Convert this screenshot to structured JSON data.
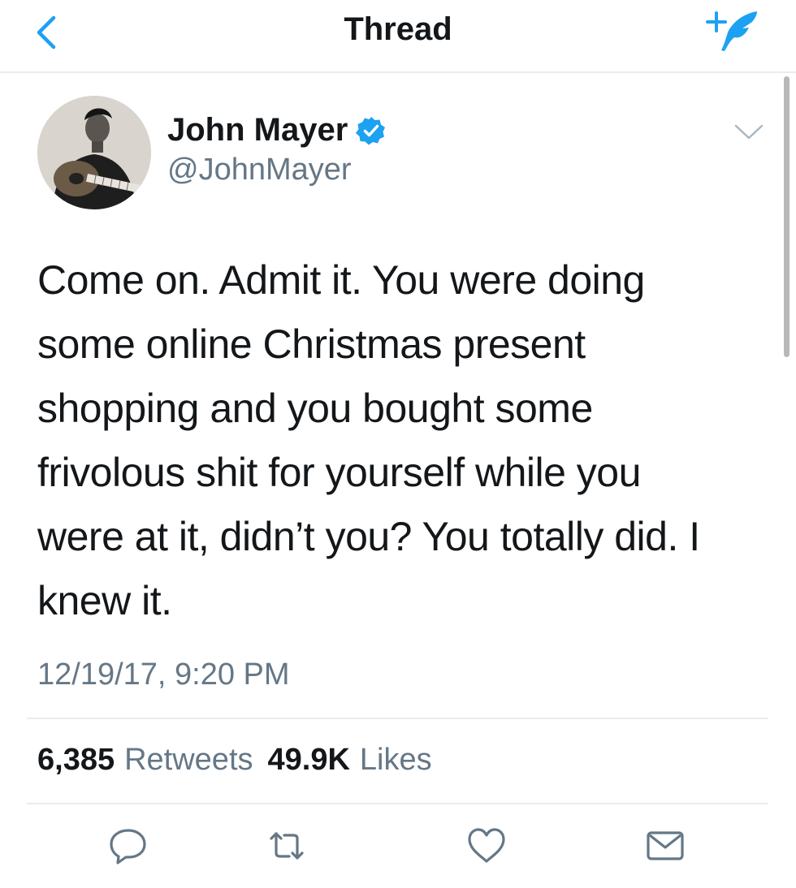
{
  "nav": {
    "title": "Thread",
    "back_icon": "chevron-left-icon",
    "compose_icon": "compose-tweet-icon"
  },
  "tweet": {
    "author_name": "John Mayer",
    "author_handle": "@JohnMayer",
    "verified": true,
    "text": "Come on. Admit it. You were doing\nsome online Christmas present\nshopping and you bought some\nfrivolous shit for yourself while you\nwere at it, didn’t you? You totally did. I\nknew it.",
    "timestamp": "12/19/17, 9:20 PM"
  },
  "stats": {
    "retweets_count": "6,385",
    "retweets_label": "Retweets",
    "likes_count": "49.9K",
    "likes_label": "Likes"
  },
  "actions": [
    "reply-icon",
    "retweet-icon",
    "like-icon",
    "share-icon"
  ],
  "colors": {
    "accent": "#1da1f2",
    "text": "#14171a",
    "secondary": "#657786",
    "divider": "#e6ecf0"
  }
}
